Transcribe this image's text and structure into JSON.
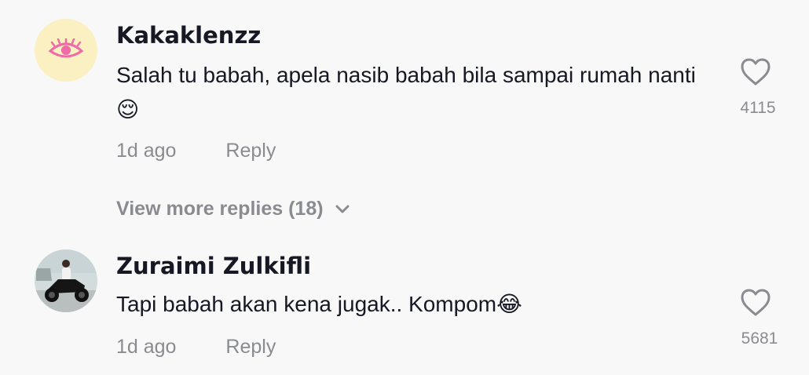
{
  "comments": [
    {
      "username": "Kakaklenzz",
      "text": "Salah tu babah, apela nasib babah bila sampai rumah nanti 😌",
      "time": "1d ago",
      "reply_label": "Reply",
      "likes": "4115",
      "avatar_icon": "eye-icon"
    },
    {
      "username": "Zuraimi Zulkifli",
      "text": "Tapi babah akan kena jugak.. Kompom😂",
      "time": "1d ago",
      "reply_label": "Reply",
      "likes": "5681",
      "avatar_icon": "motorcycle-rider-photo"
    }
  ],
  "view_more": {
    "label": "View more replies (18)",
    "icon": "chevron-down-icon"
  },
  "colors": {
    "background": "#f8f8f8",
    "username": "#161823",
    "secondary": "#8a8b91",
    "avatar_bg": "#fbf0c2",
    "eye_icon": "#f06aa8"
  }
}
